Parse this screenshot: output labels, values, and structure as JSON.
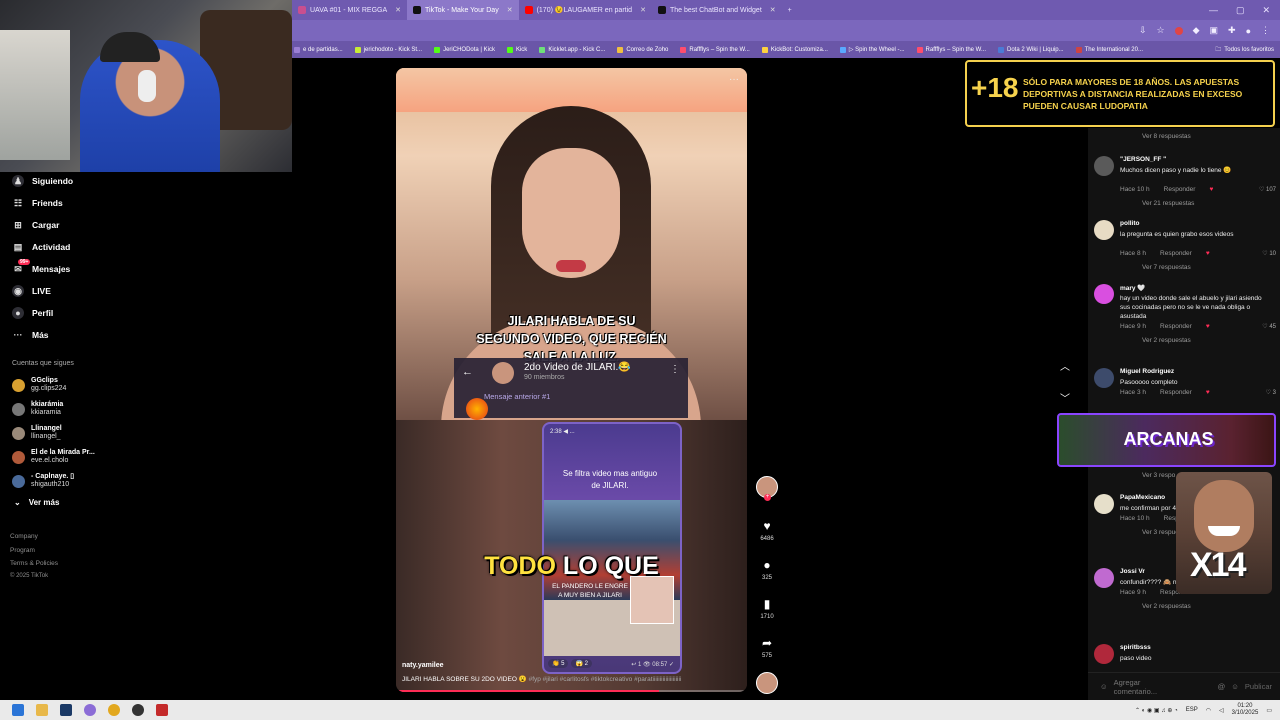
{
  "browser": {
    "tabs": [
      {
        "label": "UAVA #01 - MIX REGGA",
        "fav": "#c94f8f",
        "active": false
      },
      {
        "label": "TikTok - Make Your Day",
        "fav": "#111111",
        "active": true
      },
      {
        "label": "(170) 😉LAUGAMER en partid",
        "fav": "#ff0000",
        "active": false
      },
      {
        "label": "The best ChatBot and Widget",
        "fav": "#111111",
        "active": false
      }
    ],
    "new_tab": "+",
    "bookmarks": [
      {
        "label": "e de partidas...",
        "color": "#9b7fd4"
      },
      {
        "label": "jerichodoto - Kick St...",
        "color": "#c7ec36"
      },
      {
        "label": "JeriCHODota | Kick",
        "color": "#53fc18"
      },
      {
        "label": "Kick",
        "color": "#53fc18"
      },
      {
        "label": "Kicklet.app - Kick C...",
        "color": "#6ee07a"
      },
      {
        "label": "Correo de Zoho",
        "color": "#f0c040"
      },
      {
        "label": "Raffflys – Spin the W...",
        "color": "#ff4d6d"
      },
      {
        "label": "KickBot: Customiza...",
        "color": "#ffd23f"
      },
      {
        "label": "▷ Spin the Wheel -...",
        "color": "#5aa9ff"
      },
      {
        "label": "Raffflys – Spin the W...",
        "color": "#ff4d6d"
      },
      {
        "label": "Dota 2 Wiki | Liquip...",
        "color": "#4b7bd6"
      },
      {
        "label": "The International 20...",
        "color": "#c44"
      }
    ],
    "bookmarks_right": "Todos los favoritos"
  },
  "sidebar": {
    "nav": [
      {
        "label": "Siguiendo",
        "icon": "users-icon"
      },
      {
        "label": "Friends",
        "icon": "friends-icon"
      },
      {
        "label": "Cargar",
        "icon": "upload-icon"
      },
      {
        "label": "Actividad",
        "icon": "activity-icon"
      },
      {
        "label": "Mensajes",
        "icon": "messages-icon",
        "badge": "99+"
      },
      {
        "label": "LIVE",
        "icon": "live-icon"
      },
      {
        "label": "Perfil",
        "icon": "profile-icon"
      },
      {
        "label": "Más",
        "icon": "more-icon"
      }
    ],
    "following_title": "Cuentas que sigues",
    "following": [
      {
        "name": "GGclips",
        "handle": "gg.clips224"
      },
      {
        "name": "kkiarámia",
        "handle": "kkiaramia"
      },
      {
        "name": "Llinangel",
        "handle": "llinangel_"
      },
      {
        "name": "El de la Mirada Pr...",
        "handle": "eve.el.cholo"
      },
      {
        "name": "- Caplnaye. ▯",
        "handle": "shigauth210"
      }
    ],
    "see_more": "Ver más",
    "footer": [
      "Company",
      "Program",
      "Terms & Policies",
      "© 2025 TikTok"
    ]
  },
  "video": {
    "menu": "···",
    "caption_top": "JILARI HABLA DE SU SEGUNDO VIDEO, QUE RECIÉN SALE A LA LUZ.",
    "group_name": "2do Video de JILARI.😂",
    "group_members": "90 miembros",
    "pinned": "Mensaje anterior #1",
    "phone_status": "2:38 ◀ ...",
    "phone_bubble": "Se filtra video mas antiguo de JILARI.",
    "phone_note": "EL PANDERO LE ENGRE A MUY BIEN A JILARI",
    "reactions": [
      "👏 5",
      "😱 2"
    ],
    "phone_time": "↩ 1 👁 08:57 ✓",
    "caption_big_highlight": "TODO",
    "caption_big_rest": " LO QUE",
    "author": "naty.yamilee",
    "description": "JILARI HABLA SOBRE SU 2DO VIDEO 😮",
    "tags": " #fyp #jilari #carlitosfs #tiktokcreativo #paratiiiiiiiiiiiiiiiiiiii",
    "progress": 0.75
  },
  "actions": {
    "likes": "6486",
    "comments": "325",
    "saves": "1710",
    "shares": "575"
  },
  "comments": {
    "items": [
      {
        "user": "\"JERSON_FF \"",
        "text": "Muchos dicen paso y nadie lo tiene 😊",
        "time": "Hace 10 h",
        "likes": "107",
        "replies": "Ver 21 respuestas",
        "avatar": "#5a5a5a"
      },
      {
        "user": "pollito",
        "text": "la pregunta es quien grabo esos videos",
        "time": "Hace 8 h",
        "likes": "10",
        "replies": "Ver 7 respuestas",
        "avatar": "#e7dbc4"
      },
      {
        "user": "mary 🤍",
        "text": "hay un video donde sale el abuelo y jilari asiendo sus cocinadas pero no se le ve nada obliga o asustada",
        "time": "Hace 9 h",
        "likes": "45",
        "replies": "Ver 2 respuestas",
        "avatar": "#d94fe0"
      },
      {
        "user": "Miguel Rodriguez",
        "text": "Pasooooo completo",
        "time": "Hace 3 h",
        "likes": "3",
        "replies": "",
        "avatar": "#3d4b6b"
      },
      {
        "user": "PapaMexicano",
        "text": "me confirman por 4to video ayayay",
        "time": "Hace 10 h",
        "likes": "",
        "replies": "Ver 3 respuestas",
        "avatar": "#e6dfca"
      },
      {
        "user": "Jossi Vr",
        "text": "confundir???? 🙈 no me equivoqué 😄",
        "time": "Hace 9 h",
        "likes": "",
        "replies": "Ver 2 respuestas",
        "avatar": "#c06ad0"
      },
      {
        "user": "spiritbsss",
        "text": "paso video",
        "time": "",
        "likes": "",
        "replies": "",
        "avatar": "#b0283b"
      }
    ],
    "first_replies": "Ver 8 respuestas",
    "partial_replies": "Ver 3 respo",
    "reply_label": "Responder",
    "input_placeholder": "Agregar comentario...",
    "post_label": "Publicar"
  },
  "overlays": {
    "age_big": "+18",
    "age_text": "SÓLO PARA MAYORES DE 18 AÑOS. LAS APUESTAS DEPORTIVAS A DISTANCIA REALIZADAS EN EXCESO PUEDEN CAUSAR LUDOPATIA",
    "arcanas": "ARCANAS",
    "meme_counter": "X14"
  },
  "taskbar": {
    "time": "01:20",
    "date": "3/10/2025",
    "lang": "ESP"
  },
  "colors": {
    "accent": "#fe2c55",
    "browser_purple": "#6f5ab0",
    "banner_yellow": "#f7d34d"
  }
}
